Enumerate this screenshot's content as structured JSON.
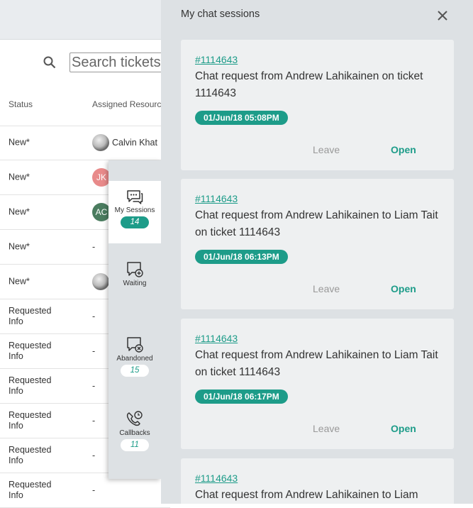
{
  "search": {
    "placeholder": "Search tickets"
  },
  "table": {
    "headers": [
      "Status",
      "Assigned Resource"
    ],
    "rows": [
      {
        "status": "New*",
        "resource": "Calvin Khat",
        "avatar": "photo"
      },
      {
        "status": "New*",
        "resource": "",
        "avatar": "JK",
        "avatar_color": "#e88a8a"
      },
      {
        "status": "New*",
        "resource": "",
        "avatar": "AC",
        "avatar_color": "#4a7c5f"
      },
      {
        "status": "New*",
        "resource": "-"
      },
      {
        "status": "New*",
        "resource": "",
        "avatar": "photo"
      },
      {
        "status": "Requested Info",
        "resource": "-"
      },
      {
        "status": "Requested Info",
        "resource": "-"
      },
      {
        "status": "Requested Info",
        "resource": "-"
      },
      {
        "status": "Requested Info",
        "resource": "-"
      },
      {
        "status": "Requested Info",
        "resource": "-"
      },
      {
        "status": "Requested Info",
        "resource": "-"
      }
    ]
  },
  "nav": {
    "items": [
      {
        "label": "My Sessions",
        "count": "14",
        "icon": "chat-bubbles-icon"
      },
      {
        "label": "Waiting",
        "count": "",
        "icon": "chat-add-icon"
      },
      {
        "label": "Abandoned",
        "count": "15",
        "icon": "chat-cancel-icon"
      },
      {
        "label": "Callbacks",
        "count": "11",
        "icon": "phone-clock-icon"
      }
    ]
  },
  "panel": {
    "title": "My chat sessions",
    "cards": [
      {
        "ticket": "#1114643",
        "text": "Chat request from Andrew Lahikainen on ticket 1114643",
        "time": "01/Jun/18 05:08PM",
        "leave": "Leave",
        "open": "Open"
      },
      {
        "ticket": "#1114643",
        "text": "Chat request from Andrew Lahikainen to Liam Tait on ticket 1114643",
        "time": "01/Jun/18 06:13PM",
        "leave": "Leave",
        "open": "Open"
      },
      {
        "ticket": "#1114643",
        "text": "Chat request from Andrew Lahikainen to Liam Tait on ticket 1114643",
        "time": "01/Jun/18 06:17PM",
        "leave": "Leave",
        "open": "Open"
      },
      {
        "ticket": "#1114643",
        "text": "Chat request from Andrew Lahikainen to Liam",
        "time": "",
        "leave": "",
        "open": ""
      }
    ]
  },
  "colors": {
    "accent": "#1d9c89",
    "panel_bg": "#dde1e4",
    "card_bg": "#eef0f1"
  }
}
